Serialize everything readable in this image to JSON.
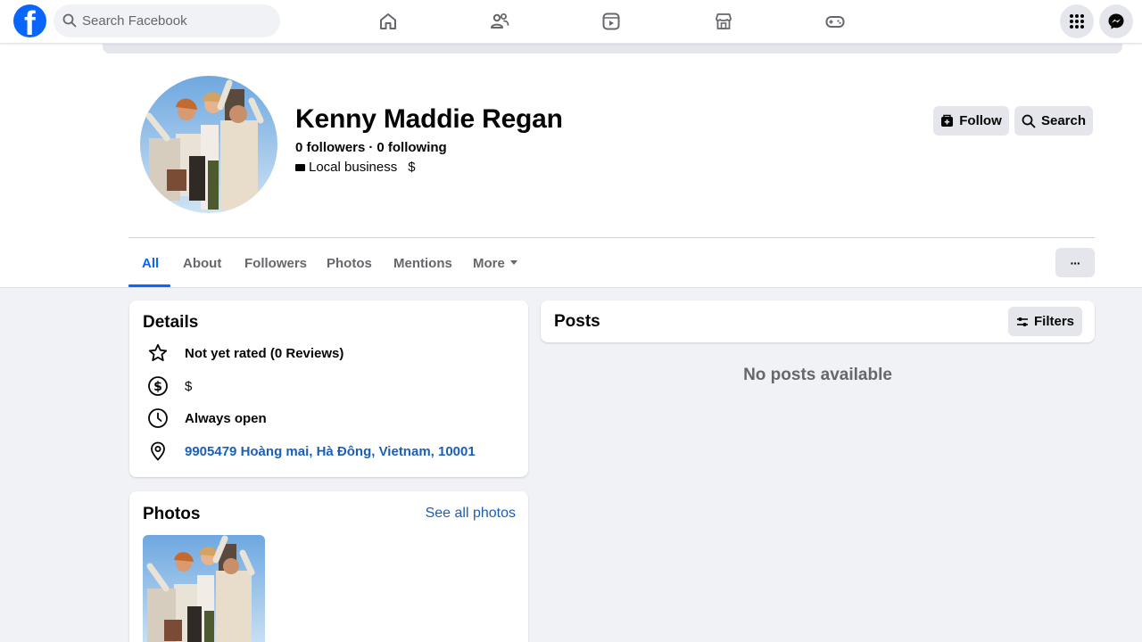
{
  "topnav": {
    "logo_icon": "facebook-logo",
    "search_placeholder": "Search Facebook",
    "nav_icons": [
      "home-icon",
      "friends-icon",
      "video-icon",
      "marketplace-icon",
      "gaming-icon"
    ],
    "right_icons": [
      "menu-grid-icon",
      "messenger-icon"
    ]
  },
  "profile": {
    "name": "Kenny Maddie Regan",
    "followers": "0 followers",
    "following": "0 following",
    "category": "Local business",
    "price": "$",
    "follow_label": "Follow",
    "search_label": "Search",
    "tabs": [
      {
        "label": "All",
        "active": true
      },
      {
        "label": "About",
        "active": false
      },
      {
        "label": "Followers",
        "active": false
      },
      {
        "label": "Photos",
        "active": false
      },
      {
        "label": "Mentions",
        "active": false
      },
      {
        "label": "More",
        "active": false
      }
    ],
    "more_options_label": "···"
  },
  "details": {
    "title": "Details",
    "items": [
      {
        "icon": "star-icon",
        "text": "Not yet rated (0 Reviews)",
        "link": false
      },
      {
        "icon": "dollar-icon",
        "text": "$",
        "link": false
      },
      {
        "icon": "clock-icon",
        "text": "Always open",
        "link": false
      },
      {
        "icon": "location-pin-icon",
        "text": "9905479 Hoàng mai, Hà Đông, Vietnam, 10001",
        "link": true
      }
    ]
  },
  "photos": {
    "title": "Photos",
    "see_all": "See all photos"
  },
  "posts": {
    "title": "Posts",
    "filters_label": "Filters",
    "empty_message": "No posts available"
  },
  "colors": {
    "brand_blue": "#0866ff",
    "link_blue": "#1b5fb8",
    "page_bg": "#f0f2f5",
    "button_gray": "#e4e6eb"
  }
}
